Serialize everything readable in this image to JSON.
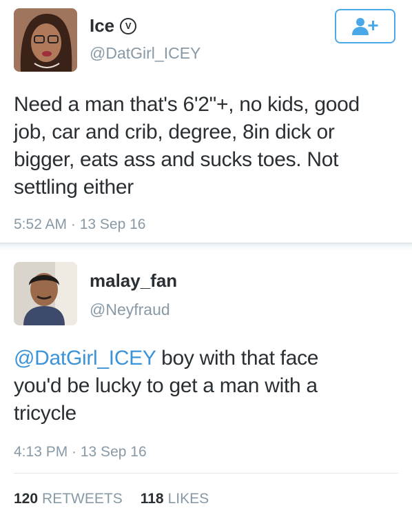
{
  "tweet1": {
    "name": "Ice",
    "verified_glyph": "V",
    "handle": "@DatGirl_ICEY",
    "text": "Need a man that's 6'2\"+, no kids, good job, car and crib, degree, 8in dick or bigger, eats ass and sucks toes. Not settling either",
    "lines": [
      "Need a man that's 6'2\"+, no kids, good",
      "job, car and crib, degree, 8in dick or",
      "bigger, eats ass and sucks toes. Not",
      "settling either"
    ],
    "timestamp": "5:52 AM · 13 Sep 16",
    "follow_icon": "add-user-icon"
  },
  "tweet2": {
    "name": "malay_fan",
    "handle": "@Neyfraud",
    "mention": "@DatGirl_ICEY",
    "lines": [
      " boy with that face",
      "you'd be lucky to get a man with a",
      "tricycle"
    ],
    "timestamp": "4:13 PM · 13 Sep 16",
    "retweets_count": "120",
    "retweets_label": "RETWEETS",
    "likes_count": "118",
    "likes_label": "LIKES"
  },
  "colors": {
    "text": "#292f33",
    "muted": "#8899a6",
    "link": "#3b94d9",
    "follow_border": "#4aa8e8"
  }
}
